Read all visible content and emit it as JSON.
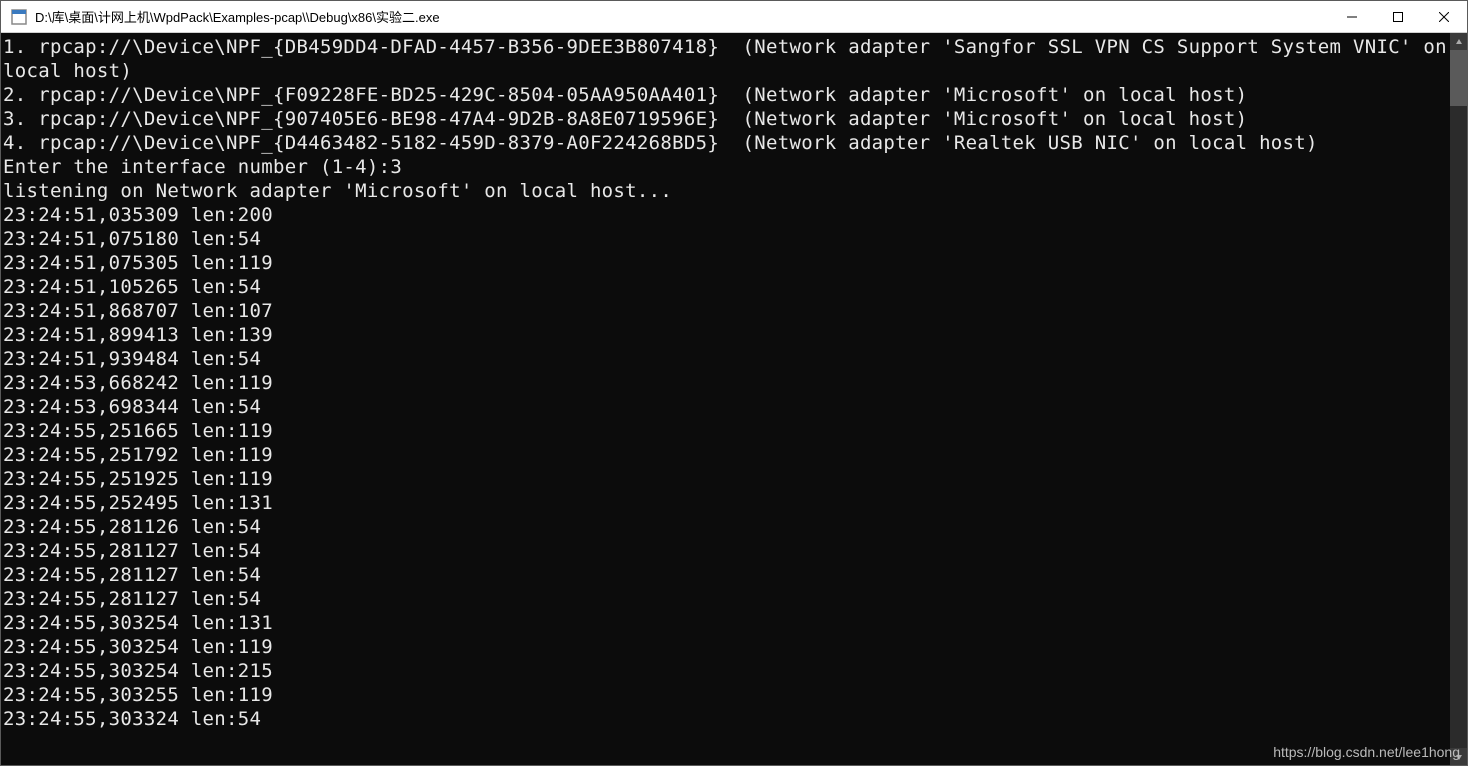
{
  "window": {
    "title": "D:\\库\\桌面\\计网上机\\WpdPack\\Examples-pcap\\\\Debug\\x86\\实验二.exe"
  },
  "interfaces": [
    {
      "idx": 1,
      "path": "rpcap://\\Device\\NPF_{DB459DD4-DFAD-4457-B356-9DEE3B807418}",
      "desc": "(Network adapter 'Sangfor SSL VPN CS Support System VNIC' on local host)"
    },
    {
      "idx": 2,
      "path": "rpcap://\\Device\\NPF_{F09228FE-BD25-429C-8504-05AA950AA401}",
      "desc": "(Network adapter 'Microsoft' on local host)"
    },
    {
      "idx": 3,
      "path": "rpcap://\\Device\\NPF_{907405E6-BE98-47A4-9D2B-8A8E0719596E}",
      "desc": "(Network adapter 'Microsoft' on local host)"
    },
    {
      "idx": 4,
      "path": "rpcap://\\Device\\NPF_{D4463482-5182-459D-8379-A0F224268BD5}",
      "desc": "(Network adapter 'Realtek USB NIC' on local host)"
    }
  ],
  "prompt": {
    "text": "Enter the interface number (1-4):",
    "input": "3"
  },
  "listening": "listening on Network adapter 'Microsoft' on local host...",
  "packets": [
    {
      "ts": "23:24:51,035309",
      "len": 200
    },
    {
      "ts": "23:24:51,075180",
      "len": 54
    },
    {
      "ts": "23:24:51,075305",
      "len": 119
    },
    {
      "ts": "23:24:51,105265",
      "len": 54
    },
    {
      "ts": "23:24:51,868707",
      "len": 107
    },
    {
      "ts": "23:24:51,899413",
      "len": 139
    },
    {
      "ts": "23:24:51,939484",
      "len": 54
    },
    {
      "ts": "23:24:53,668242",
      "len": 119
    },
    {
      "ts": "23:24:53,698344",
      "len": 54
    },
    {
      "ts": "23:24:55,251665",
      "len": 119
    },
    {
      "ts": "23:24:55,251792",
      "len": 119
    },
    {
      "ts": "23:24:55,251925",
      "len": 119
    },
    {
      "ts": "23:24:55,252495",
      "len": 131
    },
    {
      "ts": "23:24:55,281126",
      "len": 54
    },
    {
      "ts": "23:24:55,281127",
      "len": 54
    },
    {
      "ts": "23:24:55,281127",
      "len": 54
    },
    {
      "ts": "23:24:55,281127",
      "len": 54
    },
    {
      "ts": "23:24:55,303254",
      "len": 131
    },
    {
      "ts": "23:24:55,303254",
      "len": 119
    },
    {
      "ts": "23:24:55,303254",
      "len": 215
    },
    {
      "ts": "23:24:55,303255",
      "len": 119
    },
    {
      "ts": "23:24:55,303324",
      "len": 54
    }
  ],
  "watermark": "https://blog.csdn.net/lee1hong"
}
